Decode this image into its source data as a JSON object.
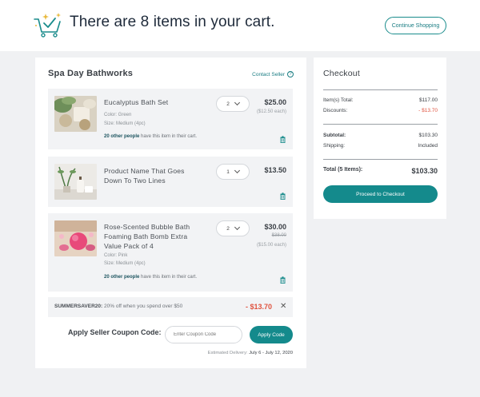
{
  "header": {
    "title": "There are 8 items in your cart.",
    "continue_label": "Continue Shopping",
    "icon": "cart-check-icon"
  },
  "seller": {
    "name": "Spa Day Bathworks",
    "contact_label": "Contact Seller",
    "items": [
      {
        "name_lines": [
          "Eucalyptus Bath Set"
        ],
        "qty": "2",
        "price": "$25.00",
        "each": "($12.50 each)",
        "color": "Color: Green",
        "size": "Size: Medium (4pc)",
        "others_bold": "20 other people",
        "others_rest": " have this item in their cart."
      },
      {
        "name_lines": [
          "Product Name That Goes",
          "Down To Two Lines"
        ],
        "qty": "1",
        "price": "$13.50"
      },
      {
        "name_lines": [
          "Rose-Scented Bubble Bath",
          "Foaming Bath Bomb Extra",
          "Value Pack of 4"
        ],
        "qty": "2",
        "price": "$30.00",
        "original": "$38.00",
        "each": "($15.00 each)",
        "color": "Color: Pink",
        "size": "Size: Medium (4pc)",
        "others_bold": "20 other people",
        "others_rest": " have this item in their cart."
      }
    ],
    "promo": {
      "code": "SUMMERSAVER20:",
      "description": " 20% off when you spend over $50",
      "amount": "- $13.70",
      "remove": "✕"
    },
    "coupon": {
      "label": "Apply Seller Coupon Code:",
      "placeholder": "Enter Coupon Code",
      "apply_label": "Apply Code"
    },
    "delivery_label": "Estimated Delivery: ",
    "delivery_dates": "July 6 - July 12, 2020"
  },
  "checkout": {
    "title": "Checkout",
    "items_total_label": "Item(s) Total:",
    "items_total": "$117.00",
    "discounts_label": "Discounts:",
    "discounts": "- $13.70",
    "subtotal_label": "Subtotal:",
    "subtotal": "$103.30",
    "shipping_label": "Shipping:",
    "shipping": "Included",
    "total_label": "Total (5 Items):",
    "total": "$103.30",
    "proceed_label": "Proceed to Checkout"
  },
  "colors": {
    "accent": "#148a8c",
    "discount": "#e0533f"
  }
}
